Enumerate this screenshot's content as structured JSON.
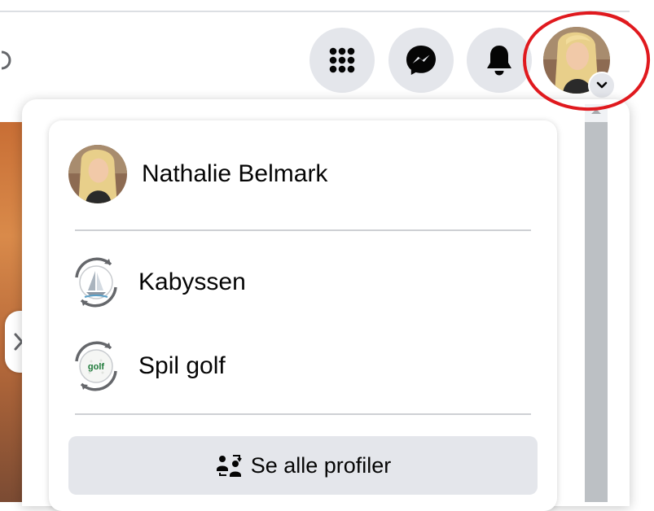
{
  "header": {
    "menu_icon": "grid-menu-icon",
    "messenger_icon": "messenger-icon",
    "notifications_icon": "bell-icon",
    "account_icon": "account-avatar",
    "highlight_color": "#e0191e"
  },
  "account_menu": {
    "current_profile": {
      "name": "Nathalie Belmark"
    },
    "other_profiles": [
      {
        "name": "Kabyssen",
        "icon": "sailboat-logo"
      },
      {
        "name": "Spil golf",
        "icon": "golf-ball-logo",
        "logo_text": "golf"
      }
    ],
    "see_all_label": "Se alle profiler"
  },
  "colors": {
    "button_bg": "#e4e6eb",
    "divider": "#ced0d4",
    "text": "#050505"
  }
}
